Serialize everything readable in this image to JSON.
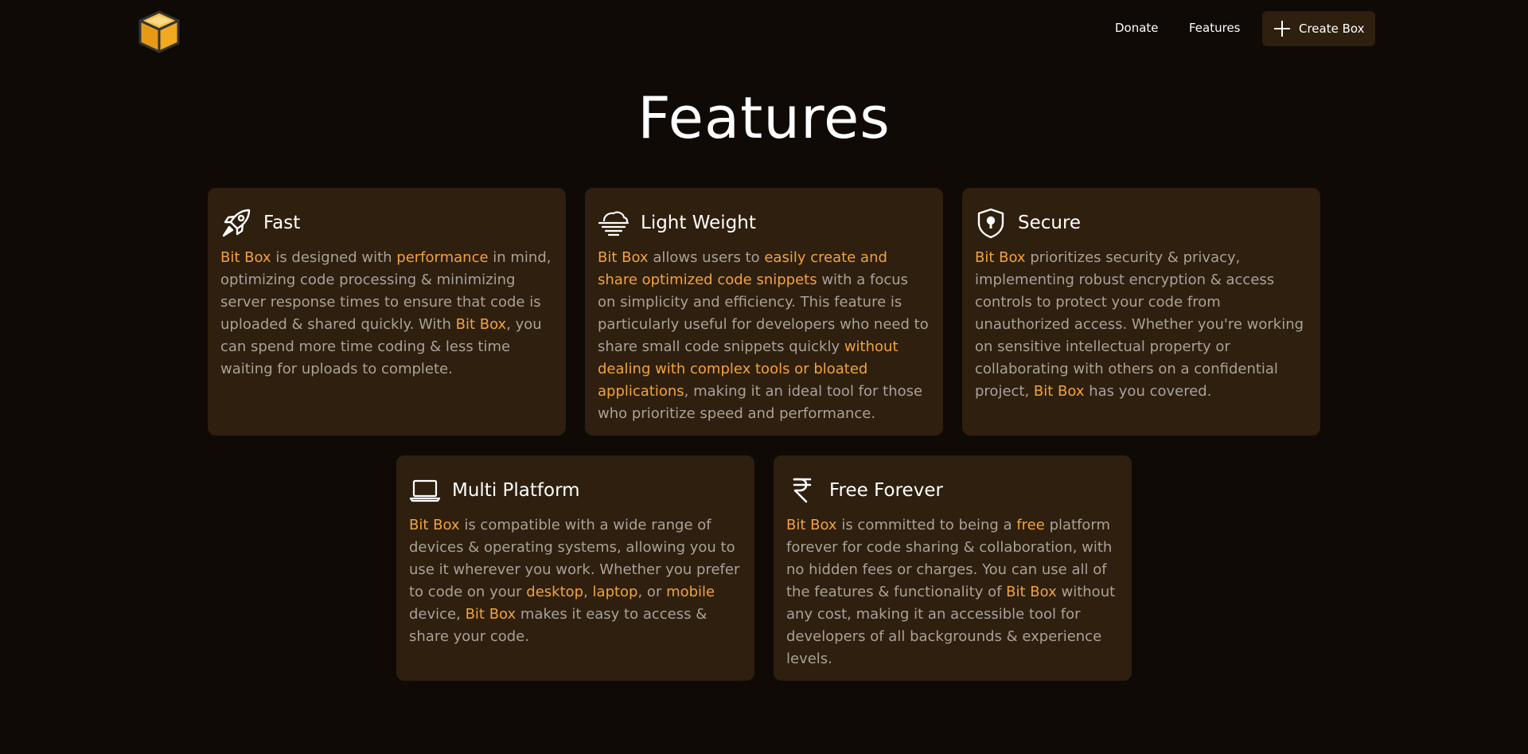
{
  "nav": {
    "donate": "Donate",
    "features": "Features",
    "create_box": "Create Box"
  },
  "page_title": "Features",
  "colors": {
    "background": "#100a06",
    "card": "#2e1f0e",
    "accent": "#f2a33c",
    "body_text": "#a9a19b"
  },
  "cards": {
    "fast": {
      "icon": "rocket-icon",
      "title": "Fast",
      "segments": [
        {
          "t": "Bit Box",
          "hl": true
        },
        {
          "t": " is designed with ",
          "hl": false
        },
        {
          "t": "performance",
          "hl": true
        },
        {
          "t": " in mind, optimizing code processing & minimizing server response times to ensure that code is uploaded & shared quickly. With ",
          "hl": false
        },
        {
          "t": "Bit Box",
          "hl": true
        },
        {
          "t": ", you can spend more time coding & less time waiting for uploads to complete.",
          "hl": false
        }
      ]
    },
    "light": {
      "icon": "wind-icon",
      "title": "Light Weight",
      "segments": [
        {
          "t": "Bit Box",
          "hl": true
        },
        {
          "t": " allows users to ",
          "hl": false
        },
        {
          "t": "easily create and share optimized code snippets",
          "hl": true
        },
        {
          "t": " with a focus on simplicity and efficiency. This feature is particularly useful for developers who need to share small code snippets quickly ",
          "hl": false
        },
        {
          "t": "without dealing with complex tools or bloated applications",
          "hl": true
        },
        {
          "t": ", making it an ideal tool for those who prioritize speed and performance.",
          "hl": false
        }
      ]
    },
    "secure": {
      "icon": "shield-lock-icon",
      "title": "Secure",
      "segments": [
        {
          "t": "Bit Box",
          "hl": true
        },
        {
          "t": " prioritizes security & privacy, implementing robust encryption & access controls to protect your code from unauthorized access. Whether you're working on sensitive intellectual property or collaborating with others on a confidential project, ",
          "hl": false
        },
        {
          "t": "Bit Box",
          "hl": true
        },
        {
          "t": " has you covered.",
          "hl": false
        }
      ]
    },
    "multi": {
      "icon": "laptop-icon",
      "title": "Multi Platform",
      "segments": [
        {
          "t": "Bit Box",
          "hl": true
        },
        {
          "t": " is compatible with a wide range of devices & operating systems, allowing you to use it wherever you work. Whether you prefer to code on your ",
          "hl": false
        },
        {
          "t": "desktop",
          "hl": true
        },
        {
          "t": ", ",
          "hl": false
        },
        {
          "t": "laptop",
          "hl": true
        },
        {
          "t": ", or ",
          "hl": false
        },
        {
          "t": "mobile",
          "hl": true
        },
        {
          "t": " device, ",
          "hl": false
        },
        {
          "t": "Bit Box",
          "hl": true
        },
        {
          "t": " makes it easy to access & share your code.",
          "hl": false
        }
      ]
    },
    "free": {
      "icon": "rupee-icon",
      "title": "Free Forever",
      "segments": [
        {
          "t": "Bit Box",
          "hl": true
        },
        {
          "t": " is committed to being a ",
          "hl": false
        },
        {
          "t": "free",
          "hl": true
        },
        {
          "t": " platform forever for code sharing & collaboration, with no hidden fees or charges. You can use all of the features & functionality of ",
          "hl": false
        },
        {
          "t": "Bit Box",
          "hl": true
        },
        {
          "t": " without any cost, making it an accessible tool for developers of all backgrounds & experience levels.",
          "hl": false
        }
      ]
    }
  }
}
